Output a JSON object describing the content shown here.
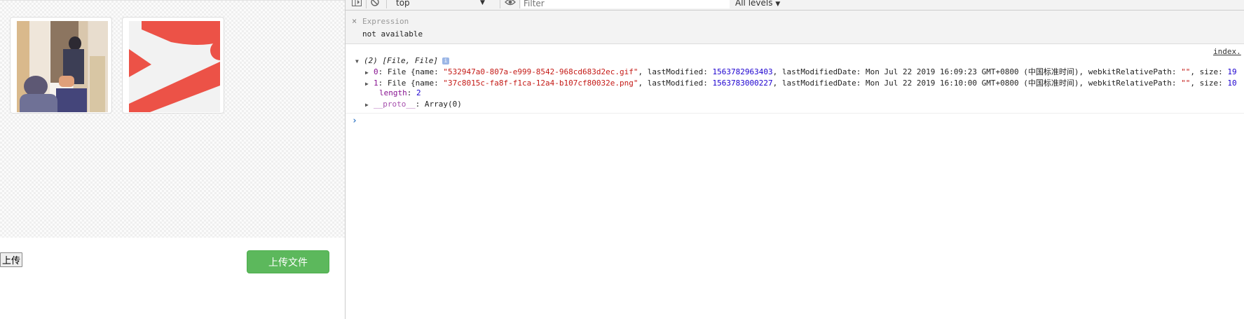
{
  "page": {
    "upload_small_label": "上传",
    "upload_button_label": "上传文件"
  },
  "devtools": {
    "toolbar": {
      "context": "top",
      "filter_placeholder": "Filter",
      "levels": "All levels"
    },
    "expression": {
      "label": "Expression",
      "value": "not available"
    },
    "source_link": "index.",
    "log": {
      "header": "(2) [File, File]",
      "info_badge": "i",
      "items": [
        {
          "index": "0",
          "type": "File",
          "name": "\"532947a0-807a-e999-8542-968cd683d2ec.gif\"",
          "lastModified": "1563782963403",
          "lastModifiedDate": "Mon Jul 22 2019 16:09:23 GMT+0800 (中国标准时间)",
          "webkitRelativePath": "\"\"",
          "size": "19"
        },
        {
          "index": "1",
          "type": "File",
          "name": "\"37c8015c-fa8f-f1ca-12a4-b107cf80032e.png\"",
          "lastModified": "1563783000227",
          "lastModifiedDate": "Mon Jul 22 2019 16:10:00 GMT+0800 (中国标准时间)",
          "webkitRelativePath": "\"\"",
          "size": "10"
        }
      ],
      "length_key": "length",
      "length_value": "2",
      "proto_key": "__proto__",
      "proto_value": "Array(0)"
    },
    "prompt_symbol": "›"
  },
  "colors": {
    "upload_button_bg": "#5cb85c",
    "string_value": "#c41a16",
    "number_value": "#1c00cf",
    "property_key": "#881391"
  }
}
